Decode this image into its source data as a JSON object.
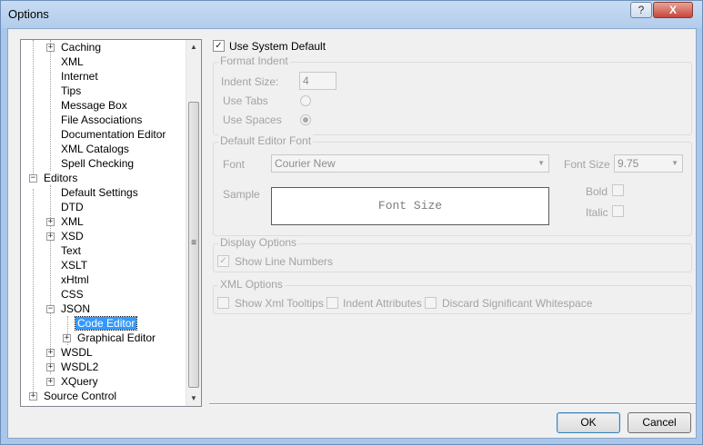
{
  "window": {
    "title": "Options",
    "help_label": "?",
    "close_label": "X"
  },
  "tree": {
    "items": [
      {
        "label": "Caching",
        "expander": "+"
      },
      {
        "label": "XML"
      },
      {
        "label": "Internet"
      },
      {
        "label": "Tips"
      },
      {
        "label": "Message Box"
      },
      {
        "label": "File Associations"
      },
      {
        "label": "Documentation Editor"
      },
      {
        "label": "XML Catalogs"
      },
      {
        "label": "Spell Checking"
      },
      {
        "label": "Editors",
        "expander": "−"
      },
      {
        "label": "Default Settings"
      },
      {
        "label": "DTD"
      },
      {
        "label": "XML",
        "expander": "+"
      },
      {
        "label": "XSD",
        "expander": "+"
      },
      {
        "label": "Text"
      },
      {
        "label": "XSLT"
      },
      {
        "label": "xHtml"
      },
      {
        "label": "CSS"
      },
      {
        "label": "JSON",
        "expander": "−"
      },
      {
        "label": "Code Editor",
        "selected": true
      },
      {
        "label": "Graphical Editor",
        "expander": "+"
      },
      {
        "label": "WSDL",
        "expander": "+"
      },
      {
        "label": "WSDL2",
        "expander": "+"
      },
      {
        "label": "XQuery",
        "expander": "+"
      },
      {
        "label": "Source Control",
        "expander": "+"
      }
    ],
    "scroll_up_icon": "▲",
    "scroll_down_icon": "▼",
    "grip_icon": "≡"
  },
  "options": {
    "use_system_default": {
      "label": "Use System Default",
      "checked": true,
      "check_mark": "✓"
    },
    "format_indent": {
      "title": "Format Indent",
      "indent_size_label": "Indent Size:",
      "indent_size_value": "4",
      "use_tabs_label": "Use Tabs",
      "use_spaces_label": "Use Spaces",
      "selected": "Use Spaces"
    },
    "editor_font": {
      "title": "Default Editor Font",
      "font_label": "Font",
      "font_value": "Courier New",
      "font_size_label": "Font Size",
      "font_size_value": "9.75",
      "sample_label": "Sample",
      "sample_text": "Font Size",
      "bold_label": "Bold",
      "italic_label": "Italic"
    },
    "display_options": {
      "title": "Display Options",
      "show_line_numbers_label": "Show Line Numbers",
      "show_line_numbers_checked": true,
      "check_mark": "✓"
    },
    "xml_options": {
      "title": "XML Options",
      "show_xml_tooltips_label": "Show Xml Tooltips",
      "indent_attributes_label": "Indent Attributes",
      "discard_whitespace_label": "Discard Significant Whitespace"
    }
  },
  "buttons": {
    "ok": "OK",
    "cancel": "Cancel"
  },
  "colors": {
    "selection": "#3399ff",
    "title_bar": "#b9d1ee",
    "disabled_text": "#a3a3a3"
  },
  "dropdown_icon": "▼"
}
